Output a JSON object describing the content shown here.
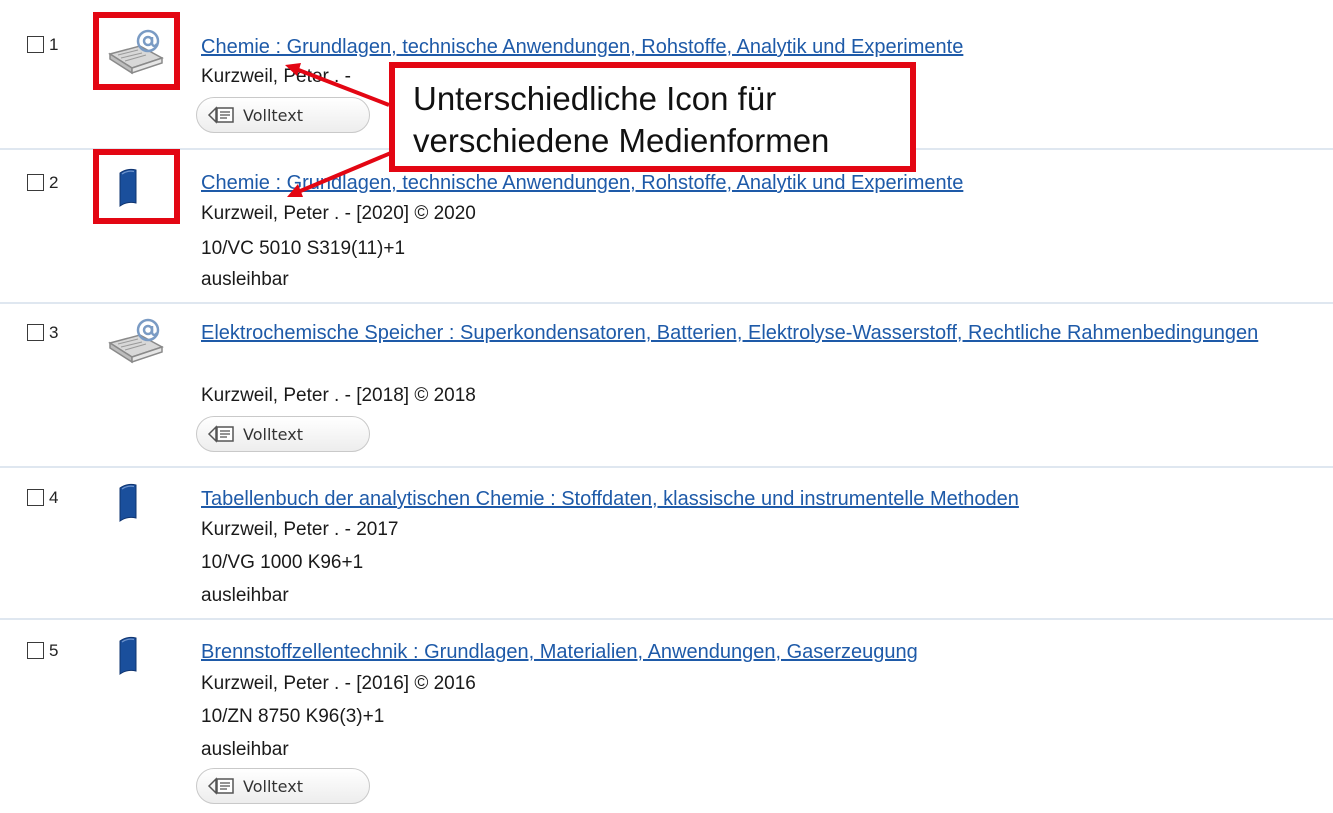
{
  "results": [
    {
      "number": "1",
      "media_icon": "ebook-at-icon",
      "title": "Chemie : Grundlagen, technische Anwendungen, Rohstoffe, Analytik und Experimente",
      "author_line": "Kurzweil, Peter . - ",
      "volltext_label": "Volltext"
    },
    {
      "number": "2",
      "media_icon": "book-icon",
      "title": "Chemie : Grundlagen, technische Anwendungen, Rohstoffe, Analytik und Experimente",
      "author_line": "Kurzweil, Peter . - [2020] © 2020",
      "call_number": "10/VC 5010 S319(11)+1",
      "availability": "ausleihbar"
    },
    {
      "number": "3",
      "media_icon": "ebook-at-icon",
      "title": "Elektrochemische Speicher : Superkondensatoren, Batterien, Elektrolyse-Wasserstoff, Rechtliche Rahmenbedingungen",
      "author_line": "Kurzweil, Peter . - [2018] © 2018",
      "volltext_label": "Volltext"
    },
    {
      "number": "4",
      "media_icon": "book-icon",
      "title": "Tabellenbuch der analytischen Chemie : Stoffdaten, klassische und instrumentelle Methoden",
      "author_line": "Kurzweil, Peter . - 2017",
      "call_number": "10/VG 1000 K96+1",
      "availability": "ausleihbar"
    },
    {
      "number": "5",
      "media_icon": "book-icon",
      "title": "Brennstoffzellentechnik : Grundlagen, Materialien, Anwendungen, Gaserzeugung",
      "author_line": "Kurzweil, Peter . - [2016] © 2016",
      "call_number": "10/ZN 8750 K96(3)+1",
      "availability": "ausleihbar",
      "volltext_label": "Volltext"
    }
  ],
  "annotation": {
    "callout_line1": "Unterschiedliche Icon für",
    "callout_line2": "verschiedene Medienformen"
  },
  "colors": {
    "link": "#1e5aa8",
    "highlight": "#e30613",
    "book_icon": "#1a4f9c"
  }
}
